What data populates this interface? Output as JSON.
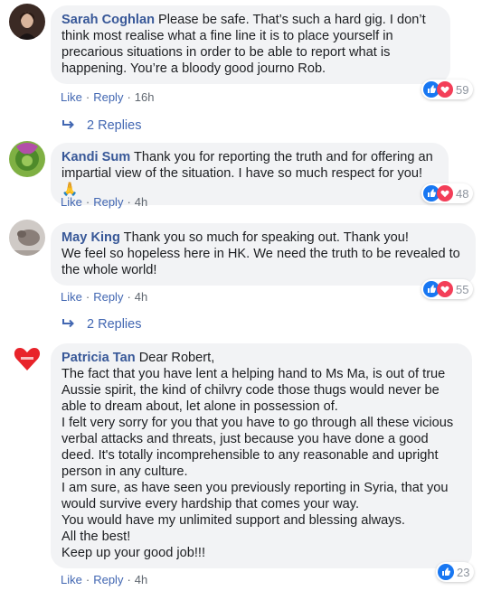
{
  "comments": [
    {
      "author": "Sarah Coghlan",
      "text": "Please be safe. That’s such a hard gig. I don’t think most realise what a fine line it is to place yourself in precarious situations in order to be able to report what is happening. You’re a bloody good journo Rob.",
      "like_label": "Like",
      "reply_label": "Reply",
      "time": "16h",
      "reaction_count": "59",
      "reactions": [
        "like-icon",
        "love-icon"
      ],
      "replies_label": "2 Replies"
    },
    {
      "author": "Kandi Sum",
      "text": "Thank you for reporting the truth and for offering an impartial view of the situation. I have so much respect for you!",
      "emoji": "🙏",
      "like_label": "Like",
      "reply_label": "Reply",
      "time": "4h",
      "reaction_count": "48",
      "reactions": [
        "like-icon",
        "love-icon"
      ]
    },
    {
      "author": "May King",
      "text": "Thank you so much for speaking out. Thank you!\nWe feel so hopeless here in HK. We need the truth to be revealed to the whole world!",
      "like_label": "Like",
      "reply_label": "Reply",
      "time": "4h",
      "reaction_count": "55",
      "reactions": [
        "like-icon",
        "love-icon"
      ],
      "replies_label": "2 Replies"
    },
    {
      "author": "Patricia Tan",
      "text": "Dear Robert,\nThe fact that you have lent a helping hand to Ms Ma, is out of true Aussie spirit, the kind of chilvry code those thugs would never be able to dream about, let alone in possession of.\nI felt very sorry for you that you have to go through all these vicious verbal attacks and threats, just because you have done a good deed. It's totally incomprehensible to any reasonable and upright person in any culture.\nI am sure, as have seen you previously reporting in Syria,   that you would survive every hardship that comes your way.\nYou would have my unlimited support and blessing always.\nAll the best!\nKeep up your good job!!!",
      "like_label": "Like",
      "reply_label": "Reply",
      "time": "4h",
      "reaction_count": "23",
      "reactions": [
        "like-icon"
      ]
    }
  ],
  "separator": "·",
  "colors": {
    "link": "#385898",
    "action": "#4267b2",
    "bubble": "#f2f3f5",
    "like": "#1877f2",
    "love": "#f33e58"
  }
}
